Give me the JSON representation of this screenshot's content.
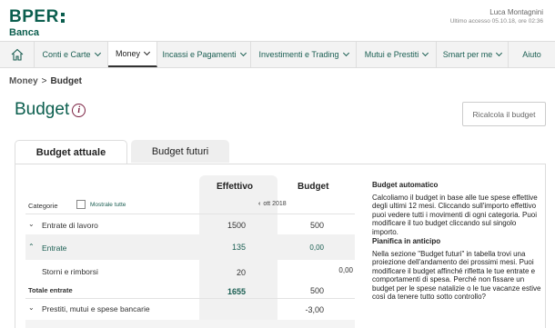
{
  "brand": {
    "name": "BPER",
    "sub": "Banca"
  },
  "user": {
    "name": "Luca Montagnini",
    "last_access": "Ultimo accesso 05.10.18, ore 02:36"
  },
  "nav": {
    "items": [
      {
        "label": "Conti e Carte",
        "chevron": true
      },
      {
        "label": "Money",
        "chevron": true,
        "active": true
      },
      {
        "label": "Incassi e Pagamenti",
        "chevron": true
      },
      {
        "label": "Investimenti e Trading",
        "chevron": true
      },
      {
        "label": "Mutui e Prestiti",
        "chevron": true
      },
      {
        "label": "Smart per me",
        "chevron": true
      },
      {
        "label": "Aiuto",
        "chevron": false
      }
    ]
  },
  "breadcrumb": {
    "parent": "Money",
    "sep": ">",
    "current": "Budget"
  },
  "page": {
    "title": "Budget",
    "info_symbol": "i",
    "recalc_button": "Ricalcola il budget"
  },
  "tabs": {
    "current": "Budget attuale",
    "future": "Budget futuri"
  },
  "table": {
    "col_effettivo": "Effettivo",
    "col_budget": "Budget",
    "categories_label": "Categorie",
    "show_all": "Mostrale tutte",
    "month_arrow": "‹",
    "month": "ott 2018",
    "rows": [
      {
        "label": "Entrate di lavoro",
        "effettivo": "1500",
        "budget": "500"
      },
      {
        "label": "Entrate",
        "effettivo": "135",
        "budget": "0,00"
      },
      {
        "label": "Storni e rimborsi",
        "effettivo": "20",
        "extra": "0,00"
      },
      {
        "label": "Totale entrate",
        "effettivo": "1655",
        "budget": "500"
      },
      {
        "label": "Prestiti, mutui e spese bancarie",
        "budget": "-3,00"
      }
    ]
  },
  "sidebar": {
    "auto_title": "Budget automatico",
    "auto_text": "Calcoliamo il budget in base alle tue spese effettive degli ultimi 12 mesi. Cliccando sull'importo effettivo puoi vedere tutti i movimenti di ogni categoria. Puoi modificare il tuo budget cliccando sul singolo importo.",
    "plan_title": "Pianifica in anticipo",
    "plan_text": "Nella sezione \"Budget futuri\" in tabella trovi una proiezione dell'andamento dei prossimi mesi. Puoi modificare il budget affinché rifletta le tue entrate e comportamenti di spesa. Perché non fissare un budget per le spese natalizie o le tue vacanze estive così da tenere tutto sotto controllo?"
  },
  "colors": {
    "brand_green": "#0b5e4e",
    "info_icon": "#7a1f40",
    "nav_bg": "#f3f3f3"
  }
}
